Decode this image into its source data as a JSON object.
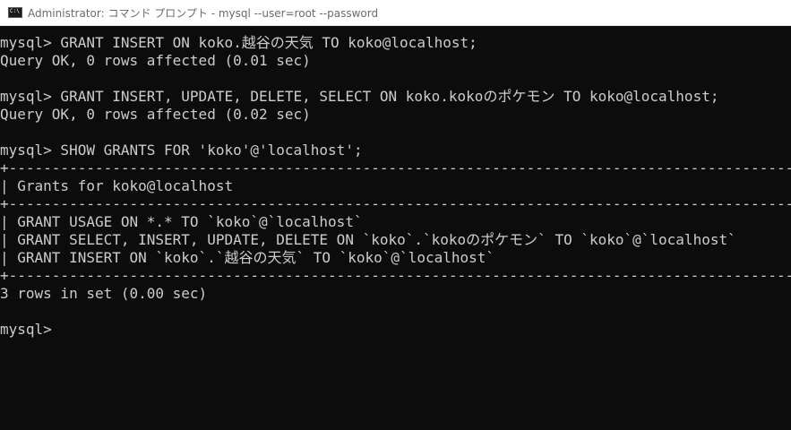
{
  "window": {
    "title": "Administrator: コマンド プロンプト - mysql  --user=root --password"
  },
  "console": {
    "lines": [
      "mysql> GRANT INSERT ON koko.越谷の天気 TO koko@localhost;",
      "Query OK, 0 rows affected (0.01 sec)",
      "",
      "mysql> GRANT INSERT, UPDATE, DELETE, SELECT ON koko.kokoのポケモン TO koko@localhost;",
      "Query OK, 0 rows affected (0.02 sec)",
      "",
      "mysql> SHOW GRANTS FOR 'koko'@'localhost';",
      "+----------------------------------------------------------------------------------------------------------------",
      "| Grants for koko@localhost",
      "+----------------------------------------------------------------------------------------------------------------",
      "| GRANT USAGE ON *.* TO `koko`@`localhost`",
      "| GRANT SELECT, INSERT, UPDATE, DELETE ON `koko`.`kokoのポケモン` TO `koko`@`localhost`",
      "| GRANT INSERT ON `koko`.`越谷の天気` TO `koko`@`localhost`",
      "+----------------------------------------------------------------------------------------------------------------",
      "3 rows in set (0.00 sec)",
      "",
      "mysql>"
    ]
  },
  "colors": {
    "background": "#0c0c0c",
    "text": "#cccccc",
    "titlebar": "#ffffff",
    "title_text": "#6b6b6b"
  }
}
